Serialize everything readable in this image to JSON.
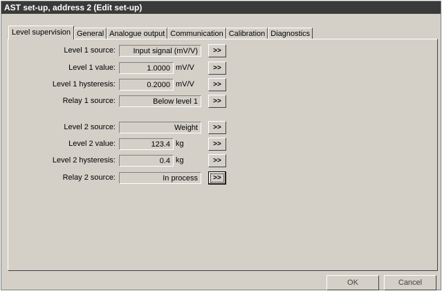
{
  "window": {
    "title": "AST set-up, address 2 (Edit set-up)"
  },
  "tabs": [
    {
      "label": "Level supervision",
      "active": true
    },
    {
      "label": "General"
    },
    {
      "label": "Analogue output"
    },
    {
      "label": "Communication"
    },
    {
      "label": "Calibration"
    },
    {
      "label": "Diagnostics"
    }
  ],
  "rows": [
    {
      "label": "Level 1 source:",
      "value": "Input signal (mV/V)",
      "unit": "",
      "button": ">>"
    },
    {
      "label": "Level 1 value:",
      "value": "1.0000",
      "unit": "mV/V",
      "button": ">>"
    },
    {
      "label": "Level 1 hysteresis:",
      "value": "0.2000",
      "unit": "mV/V",
      "button": ">>"
    },
    {
      "label": "Relay 1 source:",
      "value": "Below level 1",
      "unit": "",
      "button": ">>"
    },
    {
      "label": "Level 2 source:",
      "value": "Weight",
      "unit": "",
      "button": ">>"
    },
    {
      "label": "Level 2 value:",
      "value": "123.4",
      "unit": "kg",
      "button": ">>"
    },
    {
      "label": "Level 2 hysteresis:",
      "value": "0.4",
      "unit": "kg",
      "button": ">>"
    },
    {
      "label": "Relay 2 source:",
      "value": "In process",
      "unit": "",
      "button": ">>"
    }
  ],
  "footer": {
    "ok_label": "OK",
    "cancel_label": "Cancel"
  }
}
